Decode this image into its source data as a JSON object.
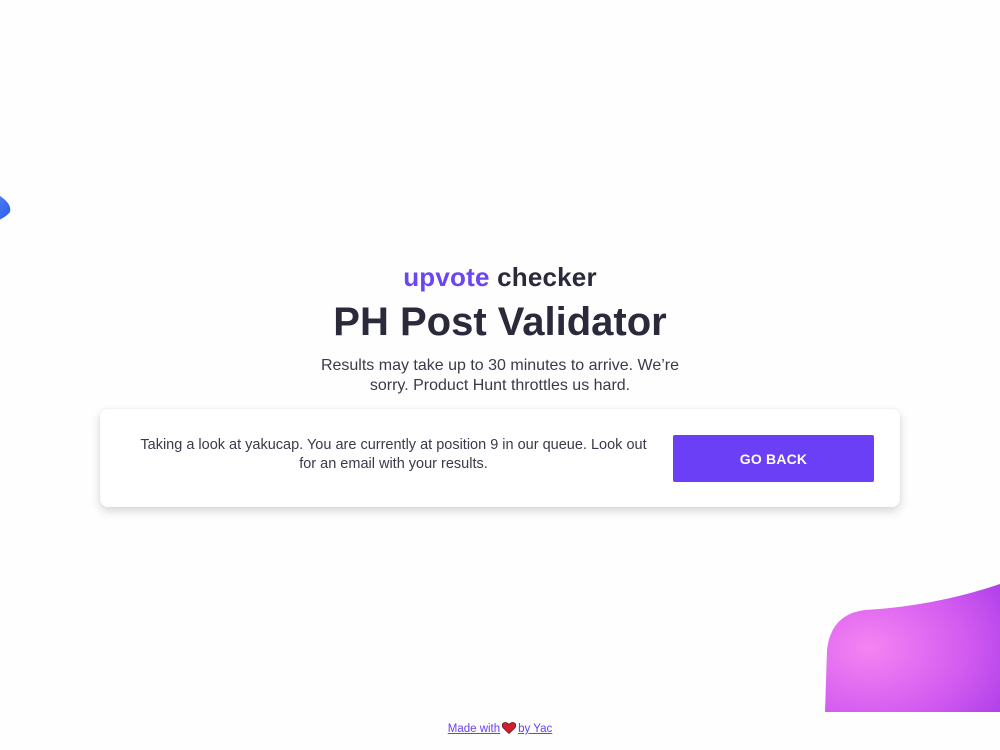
{
  "brand": {
    "word_accent": "upvote",
    "word_plain": "checker",
    "accent_color": "#6b46f5"
  },
  "header": {
    "title": "PH Post Validator",
    "subtitle": "Results may take up to 30 minutes to arrive. We’re sorry. Product Hunt throttles us hard."
  },
  "status_card": {
    "message": "Taking a look at yakucap. You are currently at position 9 in our queue. Look out for an email with your results.",
    "button_label": "GO BACK",
    "button_color": "#6a3ff5"
  },
  "footer": {
    "made_with": "Made with",
    "icon": "heart-icon",
    "by": "by Yac"
  },
  "decor": {
    "left_blob_color": "#3b6cf5",
    "right_blob_colors": [
      "#f07bf0",
      "#c94ff2"
    ]
  }
}
